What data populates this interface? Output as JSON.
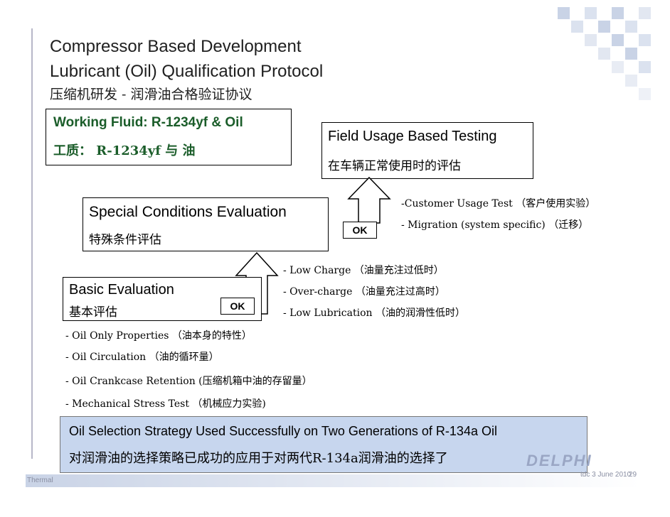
{
  "header": {
    "title_line1": "Compressor Based Development",
    "title_line2": "Lubricant (Oil) Qualification Protocol",
    "title_cn": "压缩机研发 - 润滑油合格验证协议"
  },
  "working_fluid": {
    "en": "Working Fluid: R-1234yf & Oil",
    "cn": "工质： R-1234yf 与 油"
  },
  "field_testing": {
    "en": "Field Usage Based Testing",
    "cn": "在车辆正常使用时的评估"
  },
  "field_notes": [
    "-Customer Usage Test （客户使用实验）",
    "- Migration (system specific) （迁移）"
  ],
  "special": {
    "en": "Special Conditions Evaluation",
    "cn": "特殊条件评估"
  },
  "special_notes": [
    "- Low Charge （油量充注过低时）",
    "- Over-charge （油量充注过高时）",
    "- Low Lubrication （油的润滑性低时）"
  ],
  "ok_label": "OK",
  "basic": {
    "en": "Basic Evaluation",
    "cn": "基本评估"
  },
  "basic_notes": [
    "- Oil Only Properties （油本身的特性）",
    "- Oil Circulation （油的循环量）",
    "- Oil Crankcase Retention (压缩机箱中油的存留量）",
    "- Mechanical Stress Test （机械应力实验)"
  ],
  "strategy": {
    "en": "Oil Selection Strategy Used Successfully on Two Generations of R-134a Oil",
    "cn": "对润滑油的选择策略已成功的应用于对两代R-134a润滑油的选择了"
  },
  "logo_text": "DELPHI",
  "footer": {
    "left": "Thermal",
    "right": "tdc 3 June 2010",
    "page": "29"
  },
  "colors": {
    "strategy_fill": "#c7d6ee",
    "grid_blue": "#c9d3e6",
    "title_text": "#1f1f1f"
  }
}
